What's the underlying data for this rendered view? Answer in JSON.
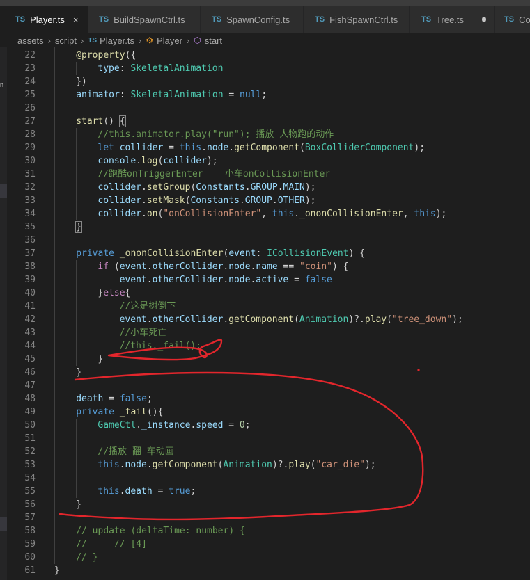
{
  "window_title_fragment": "",
  "tabs": [
    {
      "icon": "TS",
      "label": "Player.ts",
      "active": true,
      "close": "×"
    },
    {
      "icon": "TS",
      "label": "BuildSpawnCtrl.ts"
    },
    {
      "icon": "TS",
      "label": "SpawnConfig.ts"
    },
    {
      "icon": "TS",
      "label": "FishSpawnCtrl.ts"
    },
    {
      "icon": "TS",
      "label": "Tree.ts",
      "modified": true
    },
    {
      "icon": "TS",
      "label": "Co"
    }
  ],
  "breadcrumb": [
    {
      "label": "assets"
    },
    {
      "label": "script"
    },
    {
      "icon": "TS",
      "label": "Player.ts"
    },
    {
      "icon": "class-icon",
      "label": "Player"
    },
    {
      "icon": "method-icon",
      "label": "start"
    }
  ],
  "left_gutter_fragments": [
    "n"
  ],
  "colors": {
    "editor_bg": "#1e1e1e",
    "keyword": "#569cd6",
    "control": "#c586c0",
    "function": "#dcdcaa",
    "type": "#4ec9b0",
    "variable": "#9cdcfe",
    "string": "#ce9178",
    "number": "#b5cea8",
    "comment": "#6a9955",
    "annotation_ink": "#e3262c"
  },
  "code_lines": [
    {
      "n": "22",
      "indent": 1,
      "tokens": [
        [
          "fn",
          "@property"
        ],
        [
          "pun",
          "({"
        ]
      ]
    },
    {
      "n": "23",
      "indent": 2,
      "tokens": [
        [
          "var",
          "type"
        ],
        [
          "pun",
          ": "
        ],
        [
          "type",
          "SkeletalAnimation"
        ]
      ]
    },
    {
      "n": "24",
      "indent": 1,
      "tokens": [
        [
          "pun",
          "})"
        ]
      ]
    },
    {
      "n": "25",
      "indent": 1,
      "tokens": [
        [
          "var",
          "animator"
        ],
        [
          "pun",
          ": "
        ],
        [
          "type",
          "SkeletalAnimation"
        ],
        [
          "pun",
          " = "
        ],
        [
          "kw",
          "null"
        ],
        [
          "pun",
          ";"
        ]
      ]
    },
    {
      "n": "26",
      "indent": 0,
      "tokens": []
    },
    {
      "n": "27",
      "indent": 1,
      "tokens": [
        [
          "fn",
          "start"
        ],
        [
          "pun",
          "() "
        ],
        [
          "box",
          "{"
        ]
      ]
    },
    {
      "n": "28",
      "indent": 2,
      "tokens": [
        [
          "com",
          "//this.animator.play(\"run\"); 播放 人物跑的动作"
        ]
      ]
    },
    {
      "n": "29",
      "indent": 2,
      "tokens": [
        [
          "kw",
          "let "
        ],
        [
          "var",
          "collider"
        ],
        [
          "pun",
          " = "
        ],
        [
          "kw",
          "this"
        ],
        [
          "pun",
          "."
        ],
        [
          "var",
          "node"
        ],
        [
          "pun",
          "."
        ],
        [
          "fn",
          "getComponent"
        ],
        [
          "pun",
          "("
        ],
        [
          "type",
          "BoxColliderComponent"
        ],
        [
          "pun",
          ");"
        ]
      ]
    },
    {
      "n": "30",
      "indent": 2,
      "tokens": [
        [
          "var",
          "console"
        ],
        [
          "pun",
          "."
        ],
        [
          "fn",
          "log"
        ],
        [
          "pun",
          "("
        ],
        [
          "var",
          "collider"
        ],
        [
          "pun",
          ");"
        ]
      ]
    },
    {
      "n": "31",
      "indent": 2,
      "tokens": [
        [
          "com",
          "//跑酷onTriggerEnter    小车onCollisionEnter"
        ]
      ]
    },
    {
      "n": "32",
      "indent": 2,
      "tokens": [
        [
          "var",
          "collider"
        ],
        [
          "pun",
          "."
        ],
        [
          "fn",
          "setGroup"
        ],
        [
          "pun",
          "("
        ],
        [
          "var",
          "Constants"
        ],
        [
          "pun",
          "."
        ],
        [
          "var",
          "GROUP"
        ],
        [
          "pun",
          "."
        ],
        [
          "var",
          "MAIN"
        ],
        [
          "pun",
          ");"
        ]
      ]
    },
    {
      "n": "33",
      "indent": 2,
      "tokens": [
        [
          "var",
          "collider"
        ],
        [
          "pun",
          "."
        ],
        [
          "fn",
          "setMask"
        ],
        [
          "pun",
          "("
        ],
        [
          "var",
          "Constants"
        ],
        [
          "pun",
          "."
        ],
        [
          "var",
          "GROUP"
        ],
        [
          "pun",
          "."
        ],
        [
          "var",
          "OTHER"
        ],
        [
          "pun",
          ");"
        ]
      ]
    },
    {
      "n": "34",
      "indent": 2,
      "tokens": [
        [
          "var",
          "collider"
        ],
        [
          "pun",
          "."
        ],
        [
          "fn",
          "on"
        ],
        [
          "pun",
          "("
        ],
        [
          "str",
          "\"onCollisionEnter\""
        ],
        [
          "pun",
          ", "
        ],
        [
          "kw",
          "this"
        ],
        [
          "pun",
          "."
        ],
        [
          "fn",
          "_ononCollisionEnter"
        ],
        [
          "pun",
          ", "
        ],
        [
          "kw",
          "this"
        ],
        [
          "pun",
          ");"
        ]
      ]
    },
    {
      "n": "35",
      "indent": 1,
      "tokens": [
        [
          "box",
          "}"
        ]
      ]
    },
    {
      "n": "36",
      "indent": 0,
      "tokens": []
    },
    {
      "n": "37",
      "indent": 1,
      "tokens": [
        [
          "kw",
          "private "
        ],
        [
          "fn",
          "_ononCollisionEnter"
        ],
        [
          "pun",
          "("
        ],
        [
          "var",
          "event"
        ],
        [
          "pun",
          ": "
        ],
        [
          "type",
          "ICollisionEvent"
        ],
        [
          "pun",
          ") {"
        ]
      ]
    },
    {
      "n": "38",
      "indent": 2,
      "tokens": [
        [
          "ctl",
          "if "
        ],
        [
          "pun",
          "("
        ],
        [
          "var",
          "event"
        ],
        [
          "pun",
          "."
        ],
        [
          "var",
          "otherCollider"
        ],
        [
          "pun",
          "."
        ],
        [
          "var",
          "node"
        ],
        [
          "pun",
          "."
        ],
        [
          "var",
          "name"
        ],
        [
          "pun",
          " == "
        ],
        [
          "str",
          "\"coin\""
        ],
        [
          "pun",
          ") {"
        ]
      ]
    },
    {
      "n": "39",
      "indent": 3,
      "tokens": [
        [
          "var",
          "event"
        ],
        [
          "pun",
          "."
        ],
        [
          "var",
          "otherCollider"
        ],
        [
          "pun",
          "."
        ],
        [
          "var",
          "node"
        ],
        [
          "pun",
          "."
        ],
        [
          "var",
          "active"
        ],
        [
          "pun",
          " = "
        ],
        [
          "kw",
          "false"
        ]
      ]
    },
    {
      "n": "40",
      "indent": 2,
      "tokens": [
        [
          "pun",
          "}"
        ],
        [
          "ctl",
          "else"
        ],
        [
          "pun",
          "{"
        ]
      ]
    },
    {
      "n": "41",
      "indent": 3,
      "tokens": [
        [
          "com",
          "//这是树倒下"
        ]
      ]
    },
    {
      "n": "42",
      "indent": 3,
      "tokens": [
        [
          "var",
          "event"
        ],
        [
          "pun",
          "."
        ],
        [
          "var",
          "otherCollider"
        ],
        [
          "pun",
          "."
        ],
        [
          "fn",
          "getComponent"
        ],
        [
          "pun",
          "("
        ],
        [
          "type",
          "Animation"
        ],
        [
          "pun",
          ")?."
        ],
        [
          "fn",
          "play"
        ],
        [
          "pun",
          "("
        ],
        [
          "str",
          "\"tree_down\""
        ],
        [
          "pun",
          ");"
        ]
      ]
    },
    {
      "n": "43",
      "indent": 3,
      "tokens": [
        [
          "com",
          "//小车死亡"
        ]
      ]
    },
    {
      "n": "44",
      "indent": 3,
      "tokens": [
        [
          "com",
          "//this._fail();"
        ]
      ]
    },
    {
      "n": "45",
      "indent": 2,
      "tokens": [
        [
          "pun",
          "}"
        ]
      ]
    },
    {
      "n": "46",
      "indent": 1,
      "tokens": [
        [
          "pun",
          "}"
        ]
      ]
    },
    {
      "n": "47",
      "indent": 0,
      "tokens": []
    },
    {
      "n": "48",
      "indent": 1,
      "tokens": [
        [
          "var",
          "death"
        ],
        [
          "pun",
          " = "
        ],
        [
          "kw",
          "false"
        ],
        [
          "pun",
          ";"
        ]
      ]
    },
    {
      "n": "49",
      "indent": 1,
      "tokens": [
        [
          "kw",
          "private "
        ],
        [
          "fn",
          "_fail"
        ],
        [
          "pun",
          "(){"
        ]
      ]
    },
    {
      "n": "50",
      "indent": 2,
      "tokens": [
        [
          "type",
          "GameCtl"
        ],
        [
          "pun",
          "."
        ],
        [
          "var",
          "_instance"
        ],
        [
          "pun",
          "."
        ],
        [
          "var",
          "speed"
        ],
        [
          "pun",
          " = "
        ],
        [
          "num",
          "0"
        ],
        [
          "pun",
          ";"
        ]
      ]
    },
    {
      "n": "51",
      "indent": 0,
      "tokens": []
    },
    {
      "n": "52",
      "indent": 2,
      "tokens": [
        [
          "com",
          "//播放 翻 车动画"
        ]
      ]
    },
    {
      "n": "53",
      "indent": 2,
      "tokens": [
        [
          "kw",
          "this"
        ],
        [
          "pun",
          "."
        ],
        [
          "var",
          "node"
        ],
        [
          "pun",
          "."
        ],
        [
          "fn",
          "getComponent"
        ],
        [
          "pun",
          "("
        ],
        [
          "type",
          "Animation"
        ],
        [
          "pun",
          ")?."
        ],
        [
          "fn",
          "play"
        ],
        [
          "pun",
          "("
        ],
        [
          "str",
          "\"car_die\""
        ],
        [
          "pun",
          ");"
        ]
      ]
    },
    {
      "n": "54",
      "indent": 0,
      "tokens": []
    },
    {
      "n": "55",
      "indent": 2,
      "tokens": [
        [
          "kw",
          "this"
        ],
        [
          "pun",
          "."
        ],
        [
          "var",
          "death"
        ],
        [
          "pun",
          " = "
        ],
        [
          "kw",
          "true"
        ],
        [
          "pun",
          ";"
        ]
      ]
    },
    {
      "n": "56",
      "indent": 1,
      "tokens": [
        [
          "pun",
          "}"
        ]
      ]
    },
    {
      "n": "57",
      "indent": 0,
      "tokens": []
    },
    {
      "n": "58",
      "indent": 1,
      "tokens": [
        [
          "com",
          "// update (deltaTime: number) {"
        ]
      ]
    },
    {
      "n": "59",
      "indent": 1,
      "tokens": [
        [
          "com",
          "//     // [4]"
        ]
      ]
    },
    {
      "n": "60",
      "indent": 1,
      "tokens": [
        [
          "com",
          "// }"
        ]
      ]
    },
    {
      "n": "61",
      "indent": 0,
      "tokens": [
        [
          "pun",
          "}"
        ]
      ]
    }
  ]
}
